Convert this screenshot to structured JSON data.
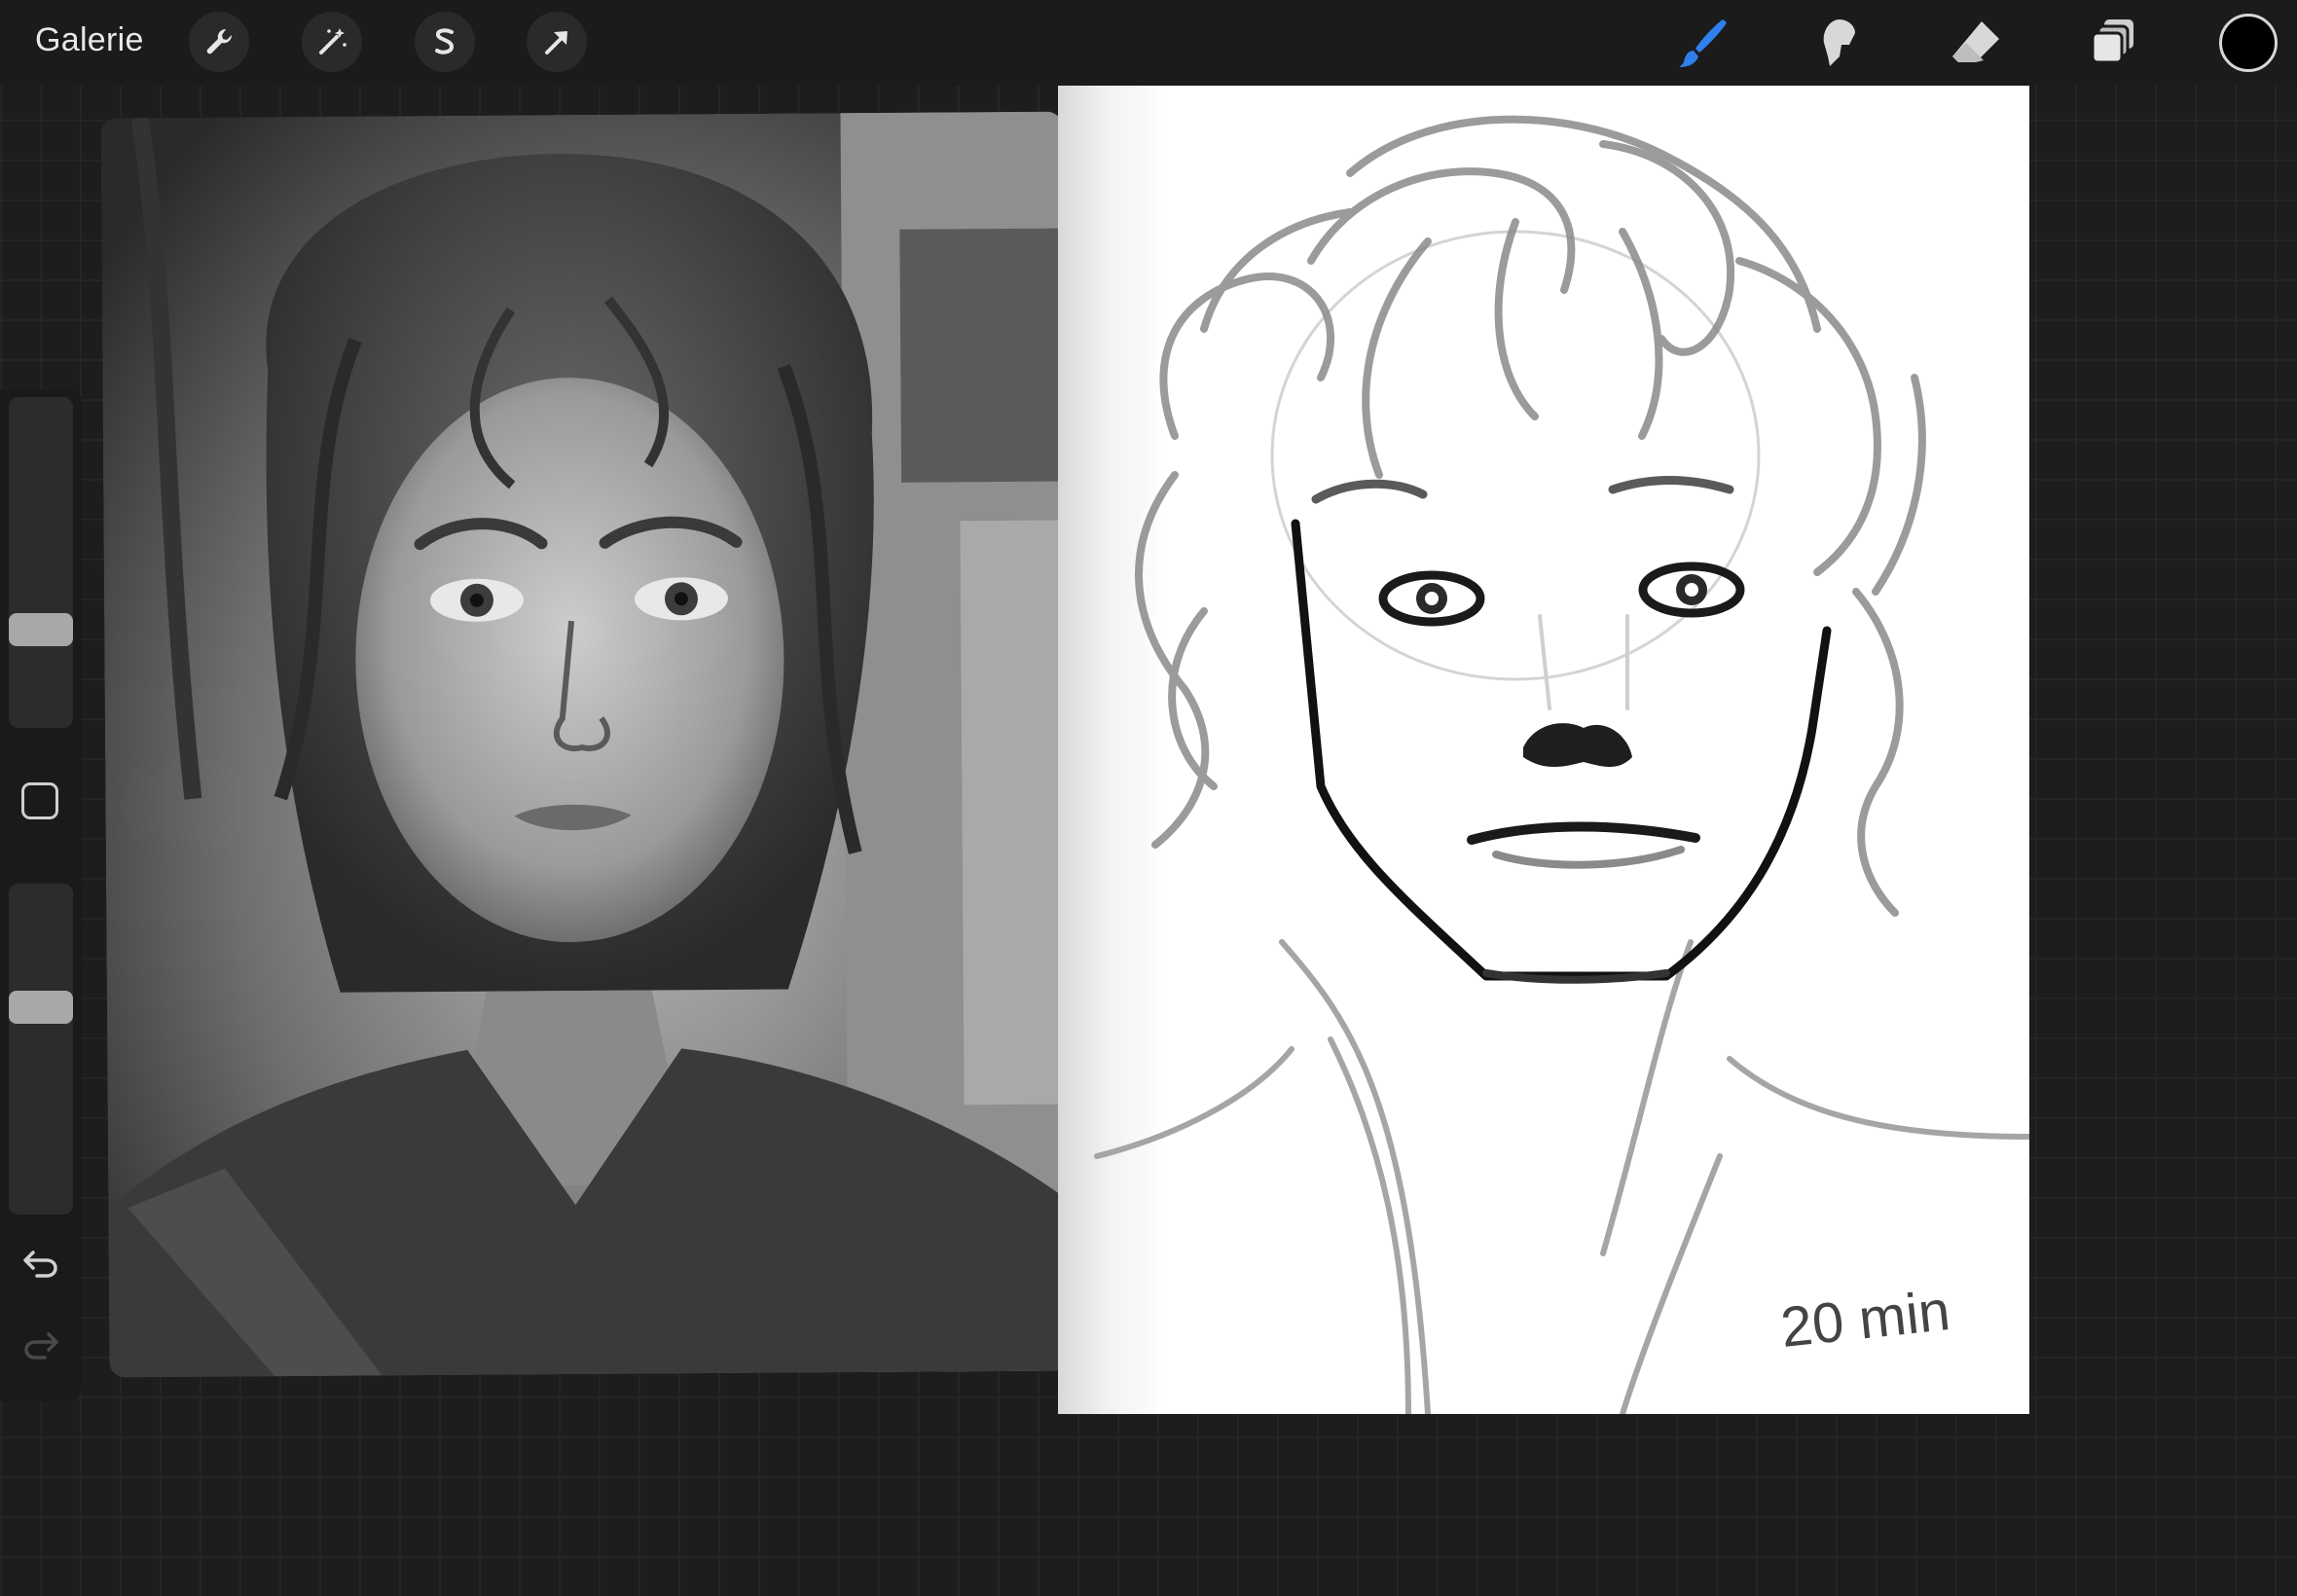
{
  "app": {
    "gallery_label": "Galerie"
  },
  "toolbar": {
    "left_tools": [
      "wrench-icon",
      "magic-wand-icon",
      "selection-s-icon",
      "transform-arrow-icon"
    ],
    "right_tools": [
      "brush-icon",
      "smudge-icon",
      "eraser-icon",
      "layers-icon"
    ],
    "active_tool": "brush",
    "active_color": "#000000",
    "accent_color": "#2f80ed"
  },
  "sidebar": {
    "brush_size_level": 0.35,
    "opacity_level": 0.6
  },
  "canvas": {
    "signature_text": "20 min"
  }
}
